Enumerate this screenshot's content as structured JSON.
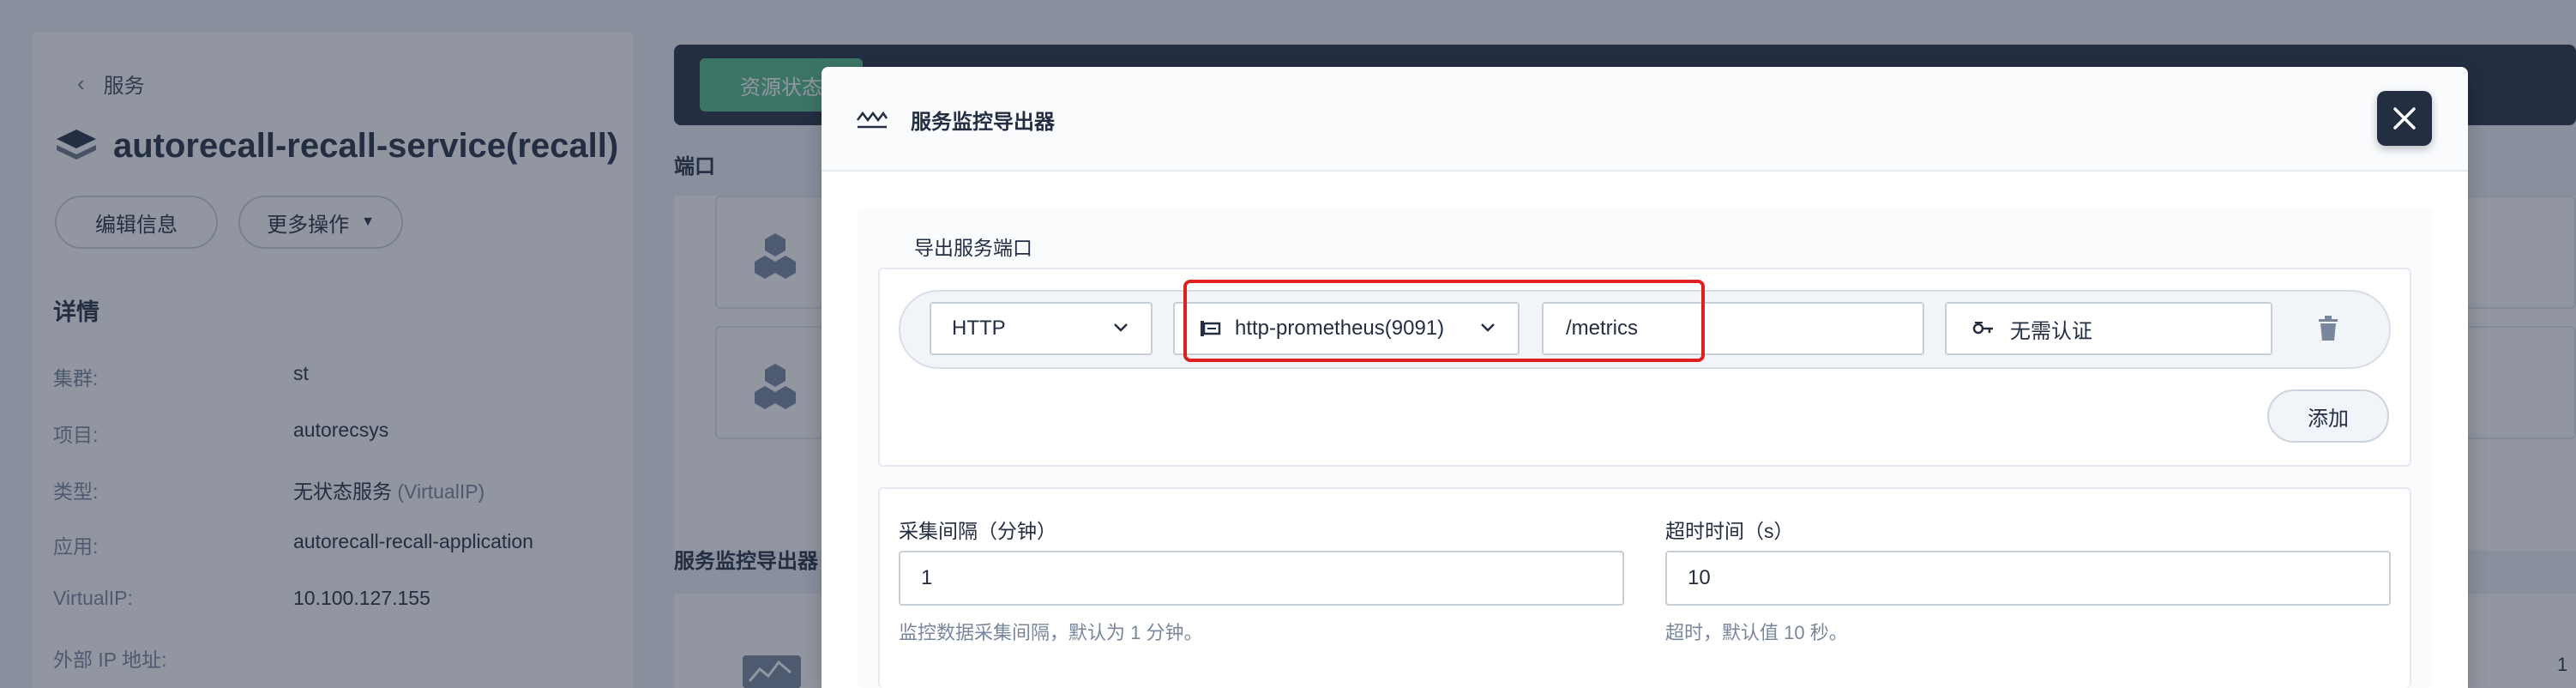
{
  "background": {
    "back_label": "服务",
    "service_name": "autorecall-recall-service(recall)",
    "edit_button": "编辑信息",
    "more_button": "更多操作",
    "details_heading": "详情",
    "details": [
      {
        "key": "集群:",
        "value": "st",
        "muted": ""
      },
      {
        "key": "项目:",
        "value": "autorecsys",
        "muted": ""
      },
      {
        "key": "类型:",
        "value": "无状态服务",
        "muted": " (VirtualIP)"
      },
      {
        "key": "应用:",
        "value": "autorecall-recall-application",
        "muted": ""
      },
      {
        "key": "VirtualIP:",
        "value": "10.100.127.155",
        "muted": ""
      },
      {
        "key": "外部 IP 地址:",
        "value": "",
        "muted": ""
      }
    ],
    "tab_label": "资源状态",
    "ports_label": "端口",
    "monitor_label": "服务监控导出器",
    "right_edge_char": "1"
  },
  "modal": {
    "title": "服务监控导出器",
    "export_port_label": "导出服务端口",
    "protocol": "HTTP",
    "port": "http-prometheus(9091)",
    "path": "/metrics",
    "auth": "无需认证",
    "add_button": "添加",
    "interval_label": "采集间隔（分钟）",
    "interval_value": "1",
    "interval_hint": "监控数据采集间隔，默认为 1 分钟。",
    "timeout_label": "超时时间（s）",
    "timeout_value": "10",
    "timeout_hint": "超时，默认值 10 秒。"
  },
  "colors": {
    "primary_dark": "#242e42",
    "accent_green": "#55bc8a",
    "highlight_red": "#e02020",
    "muted_text": "#79879c"
  }
}
